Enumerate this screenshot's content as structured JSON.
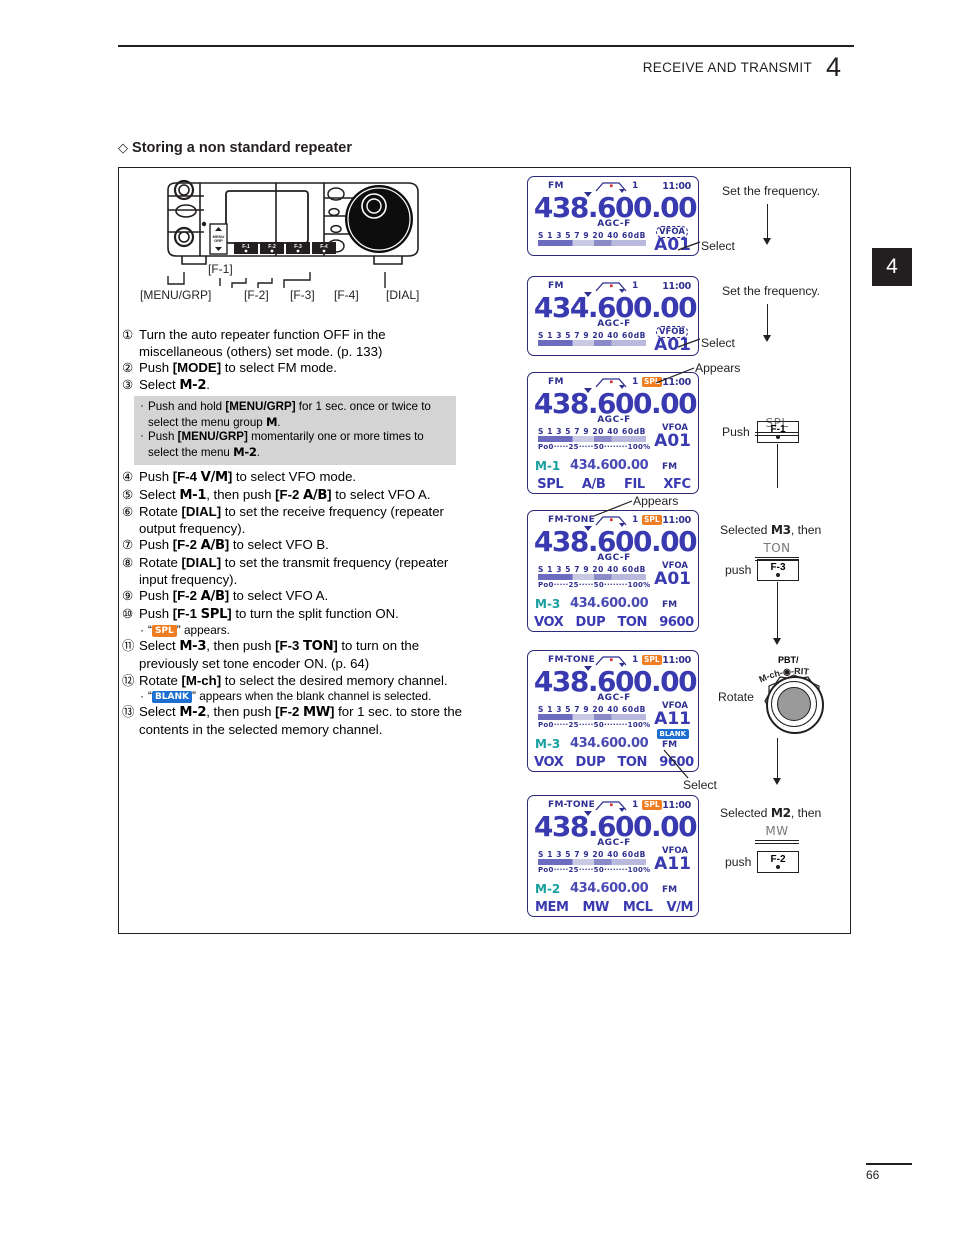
{
  "header": {
    "title": "RECEIVE AND TRANSMIT",
    "chapter": "4",
    "tab": "4"
  },
  "section": {
    "diamond": "◇",
    "heading": "Storing a non standard repeater"
  },
  "radio_callouts": {
    "f1": "[F-1]",
    "menu_grp": "[MENU/GRP]",
    "f2": "[F-2]",
    "f3": "[F-3]",
    "f4": "[F-4]",
    "dial": "[DIAL]"
  },
  "radio_panel_keys": [
    "F-1",
    "F-2",
    "F-3",
    "F-4"
  ],
  "radio_menu_key": "MENU GRP",
  "instructions": [
    {
      "num": "①",
      "html": "Turn the auto repeater function OFF in the miscellaneous (others) set mode. (p. 133)"
    },
    {
      "num": "②",
      "html": "Push <b>[MODE]</b> to select FM mode."
    },
    {
      "num": "③",
      "html": "Select <span class=\"lcdfont\">M-2</span>."
    },
    {
      "num": "④",
      "html": "Push <b>[F-4 <span class=\"lcdfont\">V/M</span>]</b> to select VFO mode."
    },
    {
      "num": "⑤",
      "html": "Select <span class=\"lcdfont\">M-1</span>, then push <b>[F-2 <span class=\"lcdfont\">A/B</span>]</b> to select VFO A."
    },
    {
      "num": "⑥",
      "html": "Rotate <b>[DIAL]</b> to set the receive frequency (repeater output frequency)."
    },
    {
      "num": "⑦",
      "html": "Push <b>[F-2 <span class=\"lcdfont\">A/B</span>]</b> to select VFO B."
    },
    {
      "num": "⑧",
      "html": "Rotate <b>[DIAL]</b> to set the transmit frequency (repeater input frequency)."
    },
    {
      "num": "⑨",
      "html": "Push <b>[F-2 <span class=\"lcdfont\">A/B</span>]</b> to select VFO A."
    },
    {
      "num": "⑩",
      "html": "Push <b>[F-1 <span class=\"lcdfont\">SPL</span>]</b> to turn the split function ON."
    },
    {
      "num": "⑪",
      "html": "Select <span class=\"lcdfont\">M-3</span>, then push <b>[F-3 <span class=\"lcdfont\">TON</span>]</b> to turn on the previously set tone encoder ON. (p. 64)"
    },
    {
      "num": "⑫",
      "html": "Rotate <b>[M-ch]</b> to select the desired memory channel."
    },
    {
      "num": "⑬",
      "html": "Select <span class=\"lcdfont\">M-2</span>, then push <b>[F-2 <span class=\"lcdfont\">MW</span>]</b> for 1 sec. to store the contents in the selected memory channel."
    }
  ],
  "note_box": {
    "bullet": "·",
    "line1_html": "Push and hold <b>[MENU/GRP]</b> for 1 sec. once or twice to select the menu group <span class=\"lcdfont\">M</span>.",
    "line2_html": "Push <b>[MENU/GRP]</b> momentarily one or more times to select the menu <span class=\"lcdfont\">M-2</span>."
  },
  "sub_notes": {
    "spl_html": "“<span class=\"badge-spl\">SPL</span>” appears.",
    "blank_html": "“<span class=\"badge-blank\">BLANK</span>” appears when the blank channel is selected."
  },
  "lcd_panels": [
    {
      "id": "lcd-1",
      "mode": "FM",
      "filter_num": "1",
      "clock": "11:00",
      "frequency": "438.600.00",
      "agc": "AGC-F",
      "smeter_scale": "S 1 3 5 7 9 20 40 60dB",
      "vfo": "VFOA",
      "mem_channel": "A01",
      "spl_badge": "",
      "po_scale": "",
      "menu_id": "",
      "sub_frequency": "",
      "sub_mode": "",
      "softkeys": []
    },
    {
      "id": "lcd-2",
      "mode": "FM",
      "filter_num": "1",
      "clock": "11:00",
      "frequency": "434.600.00",
      "agc": "AGC-F",
      "smeter_scale": "S 1 3 5 7 9 20 40 60dB",
      "vfo": "VFOB",
      "mem_channel": "A01",
      "spl_badge": "",
      "po_scale": "",
      "menu_id": "",
      "sub_frequency": "",
      "sub_mode": "",
      "softkeys": []
    },
    {
      "id": "lcd-3",
      "mode": "FM",
      "filter_num": "1",
      "clock": "11:00",
      "frequency": "438.600.00",
      "agc": "AGC-F",
      "smeter_scale": "S 1 3 5 7 9 20 40 60dB",
      "vfo": "VFOA",
      "mem_channel": "A01",
      "spl_badge": "SPL",
      "po_scale": "Po0·····25·····50········100%",
      "menu_id": "M-1",
      "sub_frequency": "434.600.00",
      "sub_mode": "FM",
      "softkeys": [
        "SPL",
        "A/B",
        "FIL",
        "XFC"
      ]
    },
    {
      "id": "lcd-4",
      "mode": "FM-TONE",
      "filter_num": "1",
      "clock": "11:00",
      "frequency": "438.600.00",
      "agc": "AGC-F",
      "smeter_scale": "S 1 3 5 7 9 20 40 60dB",
      "vfo": "VFOA",
      "mem_channel": "A01",
      "spl_badge": "SPL",
      "po_scale": "Po0·····25·····50········100%",
      "menu_id": "M-3",
      "sub_frequency": "434.600.00",
      "sub_mode": "FM",
      "softkeys": [
        "VOX",
        "DUP",
        "TON",
        "9600"
      ]
    },
    {
      "id": "lcd-5",
      "mode": "FM-TONE",
      "filter_num": "1",
      "clock": "11:00",
      "frequency": "438.600.00",
      "agc": "AGC-F",
      "smeter_scale": "S 1 3 5 7 9 20 40 60dB",
      "vfo": "VFOA",
      "mem_channel": "A11",
      "spl_badge": "SPL",
      "blank_badge": "BLANK",
      "po_scale": "Po0·····25·····50········100%",
      "menu_id": "M-3",
      "sub_frequency": "434.600.00",
      "sub_mode": "FM",
      "softkeys": [
        "VOX",
        "DUP",
        "TON",
        "9600"
      ]
    },
    {
      "id": "lcd-6",
      "mode": "FM-TONE",
      "filter_num": "1",
      "clock": "11:00",
      "frequency": "438.600.00",
      "agc": "AGC-F",
      "smeter_scale": "S 1 3 5 7 9 20 40 60dB",
      "vfo": "VFOA",
      "mem_channel": "A11",
      "spl_badge": "SPL",
      "po_scale": "Po0·····25·····50········100%",
      "menu_id": "M-2",
      "sub_frequency": "434.600.00",
      "sub_mode": "FM",
      "softkeys": [
        "MEM",
        "MW",
        "MCL",
        "V/M"
      ]
    }
  ],
  "annotations": {
    "set_freq_1": "Set the frequency.",
    "set_freq_2": "Set the frequency.",
    "select_1": "Select",
    "select_2": "Select",
    "appears_1": "Appears",
    "appears_2": "Appears",
    "appears_3": "Appears",
    "select_3": "Select",
    "push_1": "Push",
    "push_2": "push",
    "push_3": "push",
    "rotate": "Rotate",
    "selected_m3_html": "Selected <span class=\"lcdfont\">M3</span>, then",
    "selected_m2_html": "Selected <span class=\"lcdfont\">M2</span>, then",
    "fkey_spl": "SPL",
    "fkey_ton": "TON",
    "fkey_mw": "MW",
    "fkey_f1": "F-1",
    "fkey_f3": "F-3",
    "fkey_f2": "F-2",
    "knob_label_top": "PBT/",
    "knob_label_arc": "M-ch-⊙-RIT"
  },
  "footer": {
    "page_number": "66"
  },
  "colors": {
    "lcd_blue": "#3a3ab0",
    "lcd_border": "#2b2b7a",
    "spl_orange": "#f07d22",
    "blank_blue": "#1c6fd0",
    "menu_teal": "#18a0a0",
    "ink": "#231f20",
    "note_bg": "#d4d4d4"
  }
}
